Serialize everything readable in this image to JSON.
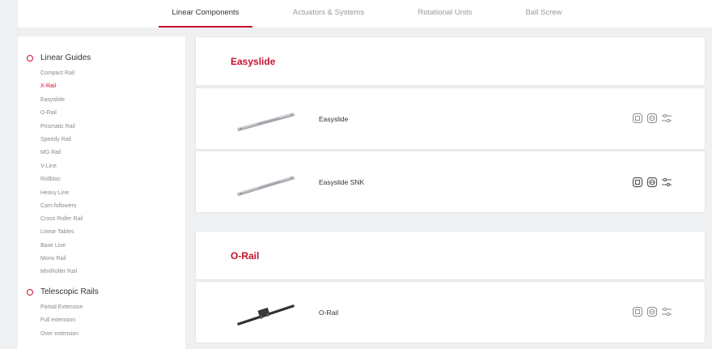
{
  "tabs": [
    {
      "label": "Linear Components",
      "active": true
    },
    {
      "label": "Actuators & Systems",
      "active": false
    },
    {
      "label": "Rotational Units",
      "active": false
    },
    {
      "label": "Ball Screw",
      "active": false
    }
  ],
  "sidebar": {
    "groups": [
      {
        "label": "Linear Guides",
        "items": [
          "Compact Rail",
          "X-Rail",
          "Easyslide",
          "O-Rail",
          "Prismatic Rail",
          "Speedy Rail",
          "MG Rail",
          "V-Line",
          "Rollbloc",
          "Heavy Line",
          "Cam followers",
          "Cross Roller Rail",
          "Linear Tables",
          "Base Line",
          "Mono Rail",
          "MiniRoller Rail"
        ]
      },
      {
        "label": "Telescopic Rails",
        "items": [
          "Partial Extension",
          "Full extension",
          "Over extension"
        ]
      }
    ],
    "active_item": "X-Rail"
  },
  "sections": [
    {
      "title": "Easyslide",
      "products": [
        {
          "name": "Easyslide",
          "image": "slide-rail-image"
        },
        {
          "name": "Easyslide SNK",
          "image": "slide-rail-image"
        }
      ]
    },
    {
      "title": "O-Rail",
      "products": [
        {
          "name": "O-Rail",
          "image": "o-rail-image"
        }
      ]
    }
  ],
  "row_icons": [
    "2d-drawing-icon",
    "3d-model-icon",
    "configure-sliders-icon"
  ],
  "colors": {
    "accent": "#c8102e",
    "background": "#eef0f2",
    "panel": "#ffffff"
  }
}
